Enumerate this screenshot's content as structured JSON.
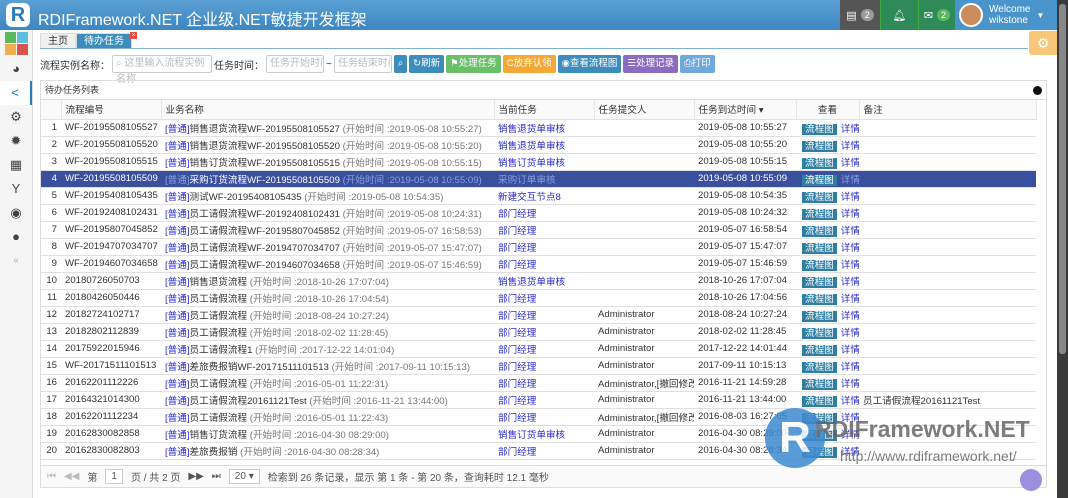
{
  "header": {
    "title": "RDIFramework.NET 企业级.NET敏捷开发框架",
    "logo_letter": "R",
    "tasks_count": "2",
    "messages_count": "2",
    "welcome": "Welcome",
    "username": "wikstone"
  },
  "tabs": [
    {
      "label": "主页"
    },
    {
      "label": "待办任务"
    }
  ],
  "toolbar": {
    "instance_label": "流程实例名称：",
    "instance_placeholder": "这里输入流程实例名称",
    "time_label": "任务时间：",
    "start_placeholder": "任务开始时间",
    "tilde": "~",
    "end_placeholder": "任务结束时间",
    "refresh": "刷新",
    "process": "处理任务",
    "reject": "放弃认领",
    "view_flow": "查看流程图",
    "records": "处理记录",
    "print": "打印"
  },
  "grid": {
    "title": "待办任务列表",
    "columns": [
      "",
      "流程编号",
      "业务名称",
      "当前任务",
      "任务提交人",
      "任务到达时间 ▾",
      "查看",
      "备注"
    ],
    "tag": "[普通]",
    "flow_btn": "流程图",
    "detail": "详情",
    "rows": [
      [
        "1",
        "WF-20195508105527",
        "销售退货流程WF-20195508105527",
        "(开始时间 :2019-05-08 10:55:27)",
        "销售退货单审核",
        "",
        "2019-05-08 10:55:27",
        ""
      ],
      [
        "2",
        "WF-20195508105520",
        "销售退货流程WF-20195508105520",
        "(开始时间 :2019-05-08 10:55:20)",
        "销售退货单审核",
        "",
        "2019-05-08 10:55:20",
        ""
      ],
      [
        "3",
        "WF-20195508105515",
        "销售订货流程WF-20195508105515",
        "(开始时间 :2019-05-08 10:55:15)",
        "销售订货单审核",
        "",
        "2019-05-08 10:55:15",
        ""
      ],
      [
        "4",
        "WF-20195508105509",
        "采购订货流程WF-20195508105509",
        "(开始时间 :2019-05-08 10:55:09)",
        "采购订单审核",
        "",
        "2019-05-08 10:55:09",
        ""
      ],
      [
        "5",
        "WF-20195408105435",
        "测试WF-20195408105435",
        "(开始时间 :2019-05-08 10:54:35)",
        "新建交互节点8",
        "",
        "2019-05-08 10:54:35",
        ""
      ],
      [
        "6",
        "WF-20192408102431",
        "员工请假流程WF-20192408102431",
        "(开始时间 :2019-05-08 10:24:31)",
        "部门经理",
        "",
        "2019-05-08 10:24:32",
        ""
      ],
      [
        "7",
        "WF-20195807045852",
        "员工请假流程WF-20195807045852",
        "(开始时间 :2019-05-07 16:58:53)",
        "部门经理",
        "",
        "2019-05-07 16:58:54",
        ""
      ],
      [
        "8",
        "WF-20194707034707",
        "员工请假流程WF-20194707034707",
        "(开始时间 :2019-05-07 15:47:07)",
        "部门经理",
        "",
        "2019-05-07 15:47:07",
        ""
      ],
      [
        "9",
        "WF-20194607034658",
        "员工请假流程WF-20194607034658",
        "(开始时间 :2019-05-07 15:46:59)",
        "部门经理",
        "",
        "2019-05-07 15:46:59",
        ""
      ],
      [
        "10",
        "20180726050703",
        "销售退货流程",
        "(开始时间 :2018-10-26 17:07:04)",
        "销售退货单审核",
        "",
        "2018-10-26 17:07:04",
        ""
      ],
      [
        "11",
        "20180426050446",
        "员工请假流程",
        "(开始时间 :2018-10-26 17:04:54)",
        "部门经理",
        "",
        "2018-10-26 17:04:56",
        ""
      ],
      [
        "12",
        "20182724102717",
        "员工请假流程",
        "(开始时间 :2018-08-24 10:27:24)",
        "部门经理",
        "Administrator",
        "2018-08-24 10:27:24",
        ""
      ],
      [
        "13",
        "20182802112839",
        "员工请假流程",
        "(开始时间 :2018-02-02 11:28:45)",
        "部门经理",
        "Administrator",
        "2018-02-02 11:28:45",
        ""
      ],
      [
        "14",
        "20175922015946",
        "员工请假流程1",
        "(开始时间 :2017-12-22 14:01:04)",
        "部门经理",
        "Administrator",
        "2017-12-22 14:01:44",
        ""
      ],
      [
        "15",
        "WF-20171511101513",
        "差旅费报销WF-20171511101513",
        "(开始时间 :2017-09-11 10:15:13)",
        "部门经理",
        "Administrator",
        "2017-09-11 10:15:13",
        ""
      ],
      [
        "16",
        "20162201112226",
        "员工请假流程",
        "(开始时间 :2016-05-01 11:22:31)",
        "部门经理",
        "Administrator,[撤回修改",
        "2016-11-21 14:59:28",
        ""
      ],
      [
        "17",
        "20164321014300",
        "员工请假流程20161121Test",
        "(开始时间 :2016-11-21 13:44:00)",
        "部门经理",
        "Administrator",
        "2016-11-21 13:44:00",
        "员工请假流程20161121Test"
      ],
      [
        "18",
        "20162201112234",
        "员工请假流程",
        "(开始时间 :2016-05-01 11:22:43)",
        "部门经理",
        "Administrator,[撤回修改",
        "2016-08-03 16:27:05",
        ""
      ],
      [
        "19",
        "20162830082858",
        "销售订货流程",
        "(开始时间 :2016-04-30 08:29:00)",
        "销售订货单审核",
        "Administrator",
        "2016-04-30 08:29:00",
        ""
      ],
      [
        "20",
        "20162830082803",
        "差旅费报销",
        "(开始时间 :2016-04-30 08:28:34)",
        "部门经理",
        "Administrator",
        "2016-04-30 08:28:34",
        ""
      ]
    ]
  },
  "pager": {
    "page_prefix": "第",
    "page": "1",
    "page_suffix": "页 / 共 2 页",
    "page_size": "20 ▾",
    "summary": "检索到 26 条记录，显示 第 1 条 - 第 20 条，查询耗时 12.1 毫秒"
  },
  "watermark": {
    "brand": "RDIFramework.NET",
    "url": "http://www.rdiframework.net/"
  },
  "colors": {
    "header": "#3d86c0",
    "selected_row": "#3a4f9e",
    "link": "#2a2ad0"
  }
}
